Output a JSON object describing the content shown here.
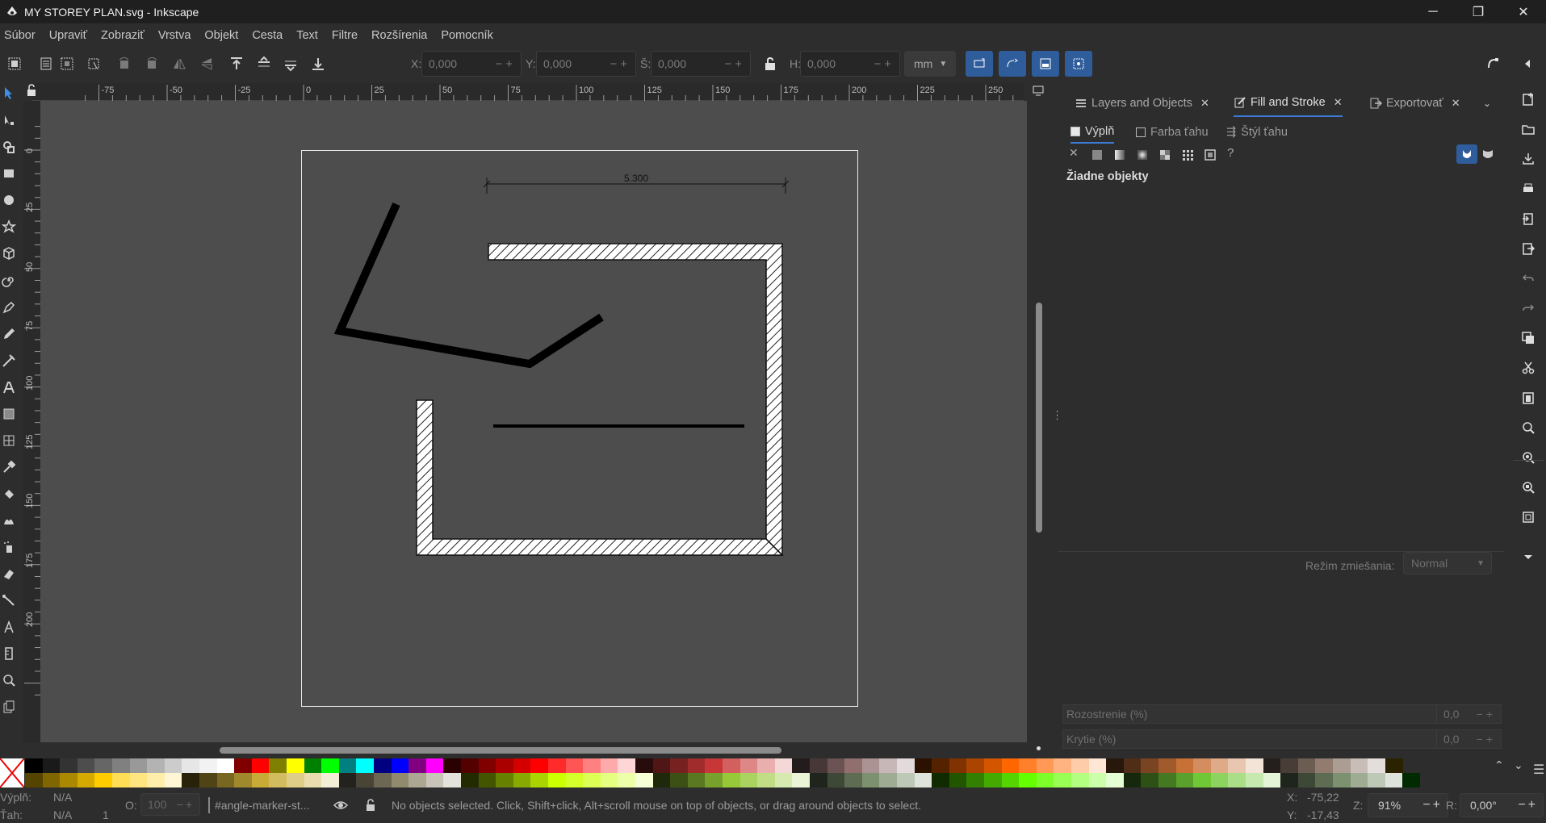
{
  "window": {
    "title": "MY STOREY PLAN.svg - Inkscape",
    "controls": [
      "minimize-icon",
      "restore-icon",
      "close-icon"
    ]
  },
  "menu": [
    "Súbor",
    "Upraviť",
    "Zobraziť",
    "Vrstva",
    "Objekt",
    "Cesta",
    "Text",
    "Filtre",
    "Rozšírenia",
    "Pomocník"
  ],
  "toolbar": {
    "x_label": "X:",
    "x_value": "0,000",
    "y_label": "Y:",
    "y_value": "0,000",
    "w_label": "Š:",
    "w_value": "0,000",
    "h_label": "H:",
    "h_value": "0,000",
    "unit": "mm",
    "plus_minus": "−+"
  },
  "hruler_labels": [
    "-75",
    "-50",
    "-25",
    "0",
    "25",
    "50",
    "75",
    "100",
    "125",
    "150",
    "175",
    "200",
    "225",
    "250"
  ],
  "vruler_labels": [
    "0",
    "25",
    "50",
    "75",
    "100",
    "125",
    "150",
    "175",
    "200"
  ],
  "drawing": {
    "dimension_text": "5.300"
  },
  "dock": {
    "tabs": [
      {
        "label": "Layers and Objects",
        "icon": "layers-icon"
      },
      {
        "label": "Fill and Stroke",
        "icon": "fill-stroke-icon"
      },
      {
        "label": "Exportovať",
        "icon": "export-icon"
      }
    ],
    "subtabs": [
      "Výplň",
      "Farba ťahu",
      "Štýl ťahu"
    ],
    "no_objects": "Žiadne objekty",
    "blend_label": "Režim zmiešania:",
    "blend_value": "Normal",
    "blur_label": "Rozostrenie (%)",
    "blur_value": "0,0",
    "opacity_label": "Krytie (%)",
    "opacity_value": "0,0"
  },
  "palette_colors_top": [
    "#000000",
    "#1a1a1a",
    "#333333",
    "#4d4d4d",
    "#666666",
    "#808080",
    "#999999",
    "#b3b3b3",
    "#cccccc",
    "#e6e6e6",
    "#f2f2f2",
    "#ffffff",
    "#800000",
    "#ff0000",
    "#808000",
    "#ffff00",
    "#008000",
    "#00ff00",
    "#008080",
    "#00ffff",
    "#000080",
    "#0000ff",
    "#800080",
    "#ff00ff",
    "#2b0000",
    "#550000",
    "#800000",
    "#aa0000",
    "#d40000",
    "#ff0000",
    "#ff2a2a",
    "#ff5555",
    "#ff8080",
    "#ffaaaa",
    "#ffd5d5",
    "#280b0b",
    "#501616",
    "#782121",
    "#a02c2c",
    "#c83737",
    "#d35f5f",
    "#de8787",
    "#e9afaf",
    "#f4d7d7",
    "#241c1c",
    "#483737",
    "#6c5353",
    "#916f6f",
    "#ac9393",
    "#c8b7b7",
    "#e3dbdb",
    "#2b1100",
    "#552200",
    "#803300",
    "#aa4400",
    "#d45500",
    "#ff6600",
    "#ff7f2a",
    "#ff9955",
    "#ffb380",
    "#ffccaa",
    "#ffe6d5",
    "#28170b",
    "#502d16",
    "#784421",
    "#a05a2c",
    "#c87137",
    "#d38d5f",
    "#deaa87",
    "#e9c6af",
    "#f4e3d7",
    "#241f1c",
    "#483e37",
    "#6c5d53",
    "#917c6f",
    "#ac9d93",
    "#c8beb7",
    "#e3dedb",
    "#2b2200"
  ],
  "palette_colors_bottom": [
    "#554400",
    "#806600",
    "#aa8800",
    "#d4aa00",
    "#ffcc00",
    "#ffdd55",
    "#ffe680",
    "#ffeeaa",
    "#fff6d5",
    "#28220b",
    "#504416",
    "#786721",
    "#a0892c",
    "#c8ab37",
    "#d3bc5f",
    "#decd87",
    "#e9ddaf",
    "#f4eed7",
    "#24221c",
    "#484537",
    "#6c6753",
    "#918a6f",
    "#aca793",
    "#c8c4b7",
    "#e3e2db",
    "#222b00",
    "#445500",
    "#668000",
    "#88aa00",
    "#aad400",
    "#ccff00",
    "#d4ff2a",
    "#ddff55",
    "#e5ff80",
    "#eeffaa",
    "#f6ffd5",
    "#1e280b",
    "#3c5016",
    "#5a7821",
    "#78a02c",
    "#96c837",
    "#abd35f",
    "#c1de87",
    "#d6e9af",
    "#ebf4d7",
    "#1f241c",
    "#3e4837",
    "#5d6c53",
    "#7c916f",
    "#9dac93",
    "#bec8b7",
    "#dee3db",
    "#112b00",
    "#225500",
    "#338000",
    "#44aa00",
    "#55d400",
    "#66ff00",
    "#7fff2a",
    "#99ff55",
    "#b3ff80",
    "#ccffaa",
    "#e5ffd5",
    "#16280b",
    "#2d5016",
    "#447821",
    "#5aa02c",
    "#71c837",
    "#8dd35f",
    "#aade87",
    "#c6e9af",
    "#e3f4d7",
    "#1f241c",
    "#3e4837",
    "#5d6c53",
    "#7c916f",
    "#9dac93",
    "#bec8b7",
    "#dee3db",
    "#002b00"
  ],
  "status": {
    "fill_label": "Výplň:",
    "fill_value": "N/A",
    "stroke_label": "Ťah:",
    "stroke_value": "N/A",
    "stroke_width": "1",
    "opacity_label": "O:",
    "opacity_value": "100",
    "layer": "#angle-marker-st...",
    "message": "No objects selected. Click, Shift+click, Alt+scroll mouse on top of objects, or drag around objects to select.",
    "x_label": "X:",
    "x_value": "-75,22",
    "y_label": "Y:",
    "y_value": "-17,43",
    "zoom_label": "Z:",
    "zoom_value": "91%",
    "rot_label": "R:",
    "rot_value": "0,00°"
  }
}
